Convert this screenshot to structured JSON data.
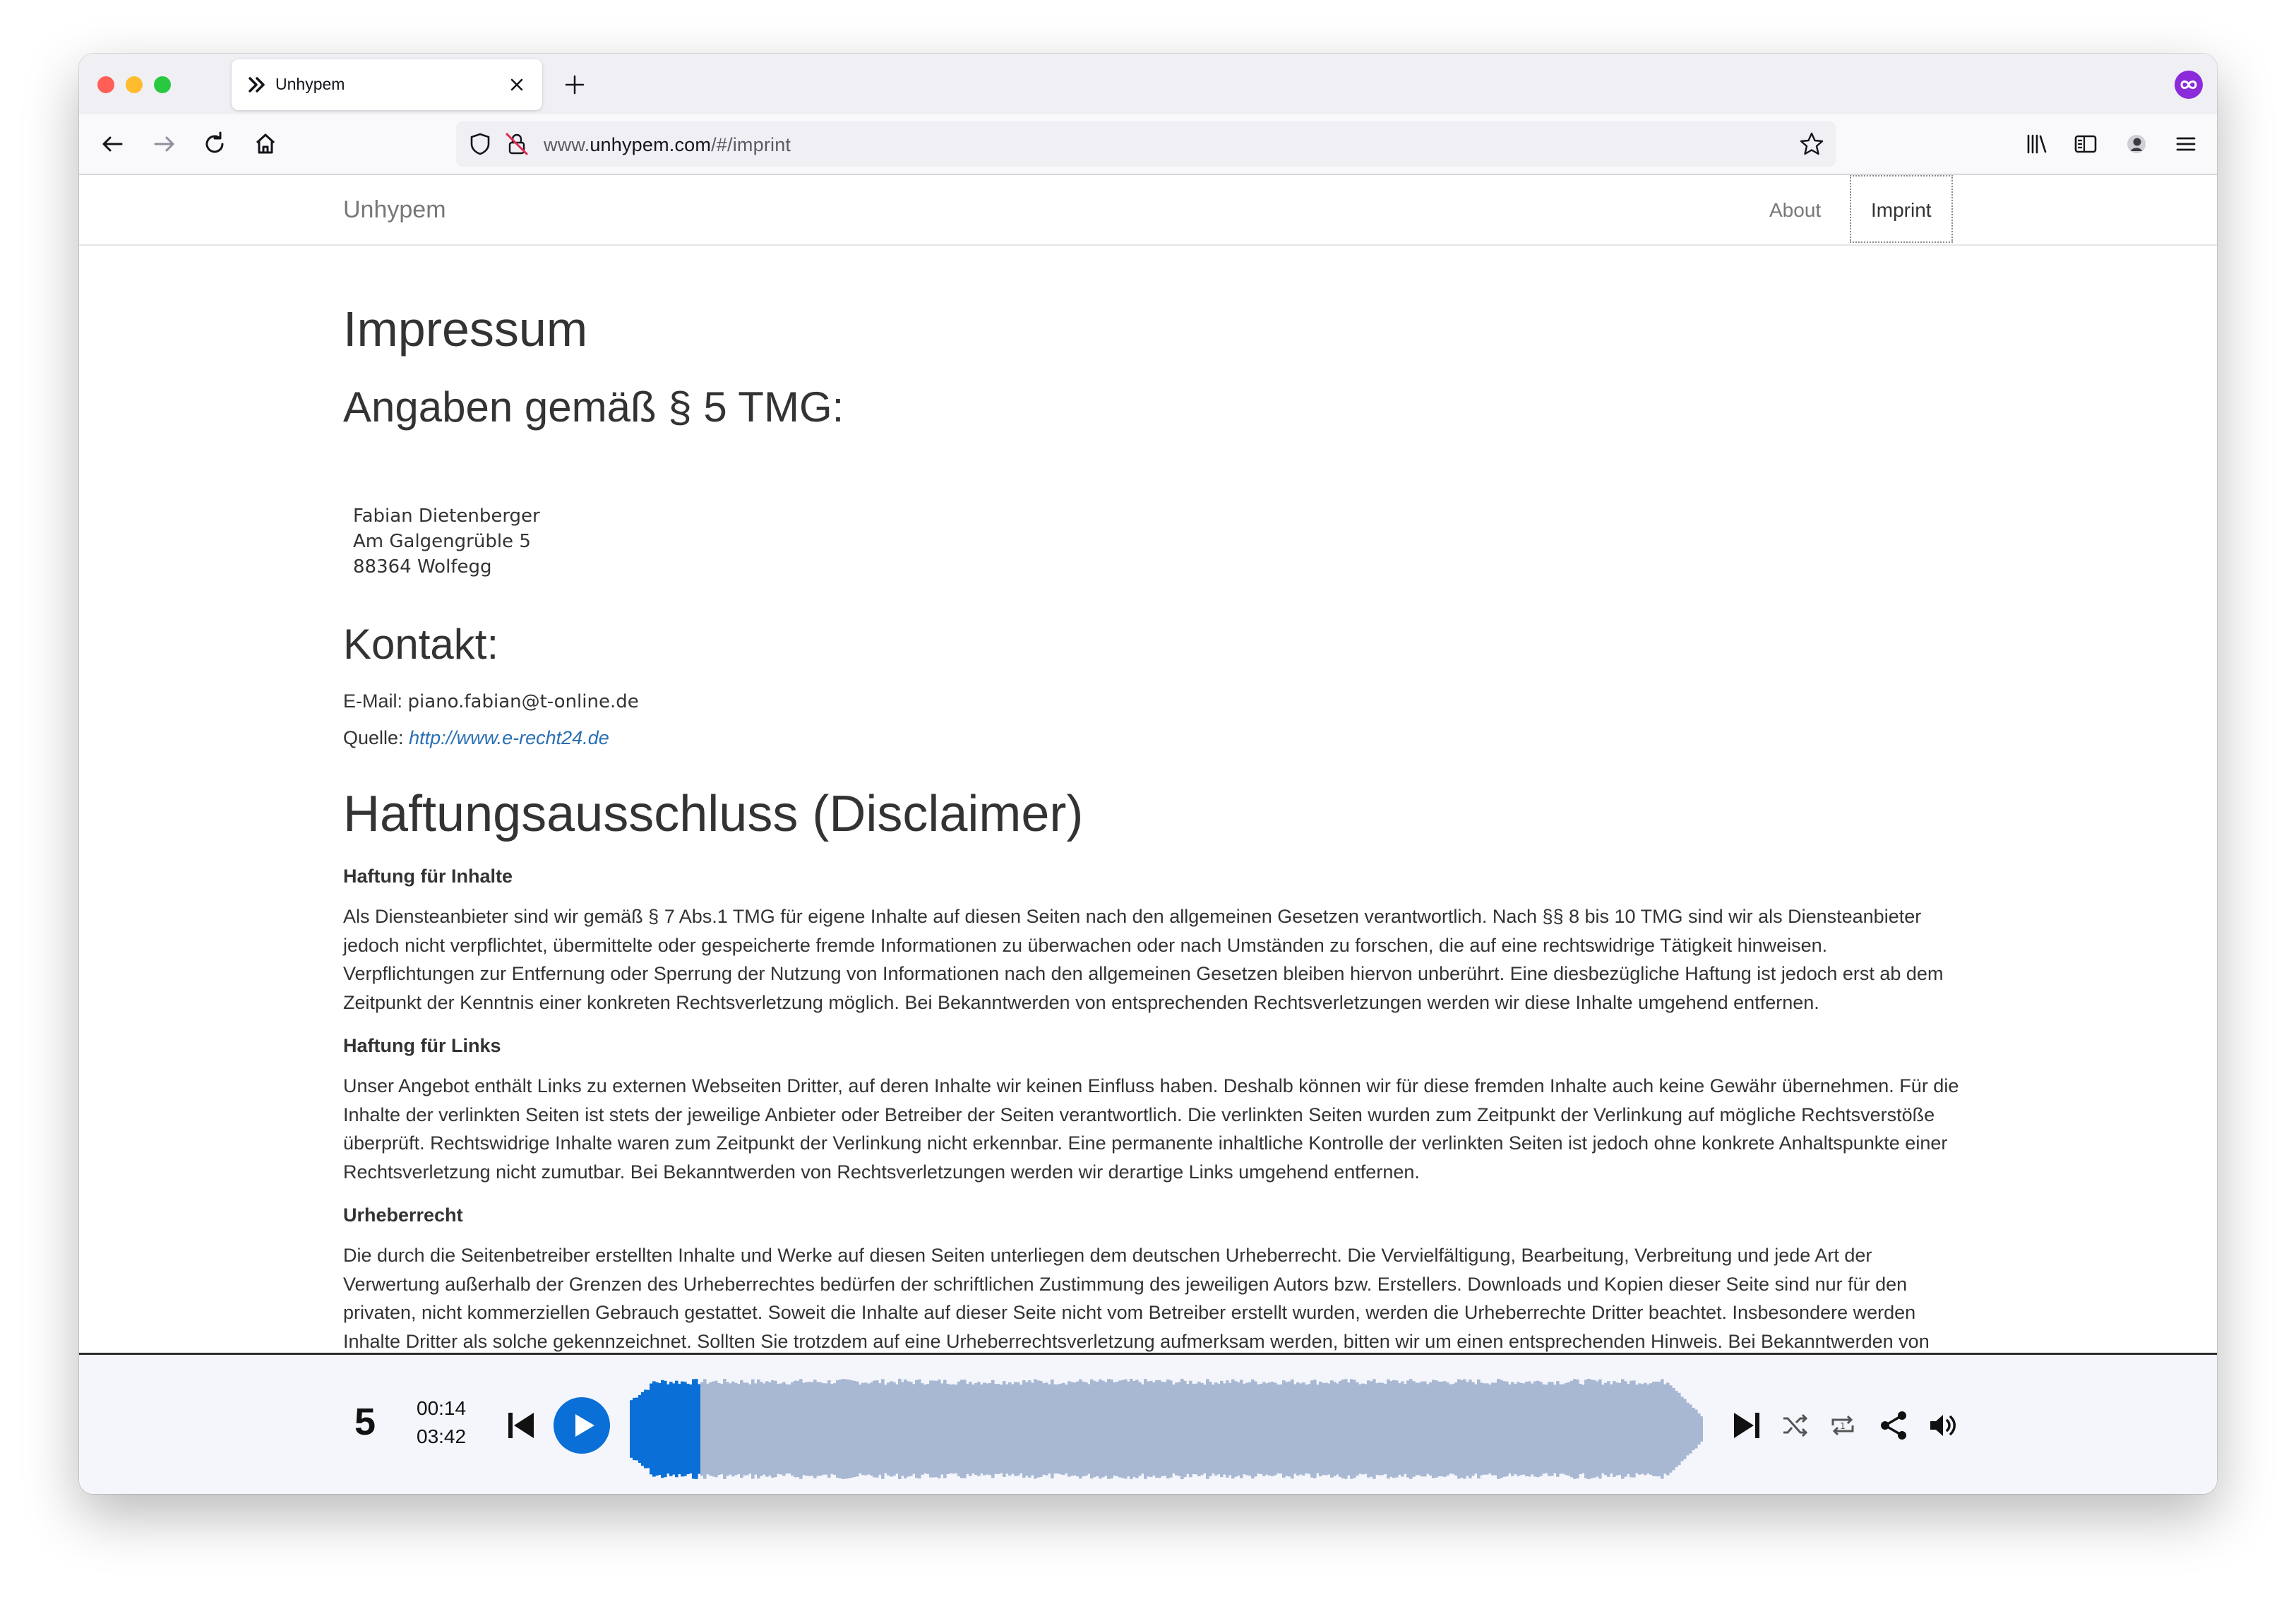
{
  "browser": {
    "tab_title": "Unhypem",
    "url_prefix": "www.",
    "url_host": "unhypem.com",
    "url_path": "/#/imprint"
  },
  "site": {
    "brand": "Unhypem",
    "nav": {
      "about": "About",
      "imprint": "Imprint"
    }
  },
  "imprint": {
    "title": "Impressum",
    "subtitle": "Angaben gemäß § 5 TMG:",
    "address": [
      "Fabian Dietenberger",
      "Am Galgengrüble 5",
      "88364 Wolfegg"
    ],
    "contact_title": "Kontakt:",
    "email_label": "E-Mail:",
    "email": "piano.fabian@t-online.de",
    "source_label": "Quelle:",
    "source_link": "http://www.e-recht24.de"
  },
  "disclaimer": {
    "title": "Haftungsausschluss (Disclaimer)",
    "sections": [
      {
        "heading": "Haftung für Inhalte",
        "text": "Als Diensteanbieter sind wir gemäß § 7 Abs.1 TMG für eigene Inhalte auf diesen Seiten nach den allgemeinen Gesetzen verantwortlich. Nach §§ 8 bis 10 TMG sind wir als Diensteanbieter jedoch nicht verpflichtet, übermittelte oder gespeicherte fremde Informationen zu überwachen oder nach Umständen zu forschen, die auf eine rechtswidrige Tätigkeit hinweisen. Verpflichtungen zur Entfernung oder Sperrung der Nutzung von Informationen nach den allgemeinen Gesetzen bleiben hiervon unberührt. Eine diesbezügliche Haftung ist jedoch erst ab dem Zeitpunkt der Kenntnis einer konkreten Rechtsverletzung möglich. Bei Bekanntwerden von entsprechenden Rechtsverletzungen werden wir diese Inhalte umgehend entfernen."
      },
      {
        "heading": "Haftung für Links",
        "text": "Unser Angebot enthält Links zu externen Webseiten Dritter, auf deren Inhalte wir keinen Einfluss haben. Deshalb können wir für diese fremden Inhalte auch keine Gewähr übernehmen. Für die Inhalte der verlinkten Seiten ist stets der jeweilige Anbieter oder Betreiber der Seiten verantwortlich. Die verlinkten Seiten wurden zum Zeitpunkt der Verlinkung auf mögliche Rechtsverstöße überprüft. Rechtswidrige Inhalte waren zum Zeitpunkt der Verlinkung nicht erkennbar. Eine permanente inhaltliche Kontrolle der verlinkten Seiten ist jedoch ohne konkrete Anhaltspunkte einer Rechtsverletzung nicht zumutbar. Bei Bekanntwerden von Rechtsverletzungen werden wir derartige Links umgehend entfernen."
      },
      {
        "heading": "Urheberrecht",
        "text": "Die durch die Seitenbetreiber erstellten Inhalte und Werke auf diesen Seiten unterliegen dem deutschen Urheberrecht. Die Vervielfältigung, Bearbeitung, Verbreitung und jede Art der Verwertung außerhalb der Grenzen des Urheberrechtes bedürfen der schriftlichen Zustimmung des jeweiligen Autors bzw. Erstellers. Downloads und Kopien dieser Seite sind nur für den privaten, nicht kommerziellen Gebrauch gestattet. Soweit die Inhalte auf dieser Seite nicht vom Betreiber erstellt wurden, werden die Urheberrechte Dritter beachtet. Insbesondere werden Inhalte Dritter als solche gekennzeichnet. Sollten Sie trotzdem auf eine Urheberrechtsverletzung aufmerksam werden, bitten wir um einen entsprechenden Hinweis. Bei Bekanntwerden von Rechtsverletzungen werden wir derartige Inhalte umgehend entfernen."
      }
    ]
  },
  "player": {
    "track_number": "5",
    "elapsed": "00:14",
    "duration": "03:42",
    "progress": 0.064,
    "colors": {
      "played": "#0a6fd6",
      "unplayed": "#a8b8d2",
      "accent": "#0a6fd6"
    },
    "icons": [
      "skip-back-icon",
      "play-icon",
      "skip-forward-icon",
      "shuffle-icon",
      "repeat-icon",
      "share-icon",
      "volume-icon"
    ]
  }
}
